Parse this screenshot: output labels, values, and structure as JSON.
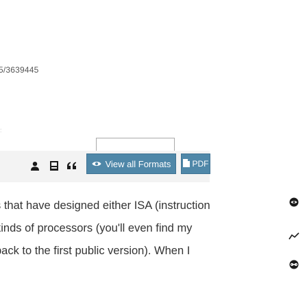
{
  "article": {
    "doi_fragment": "5/3639445",
    "paragraph_lines": [
      "s that have designed either ISA (instruction",
      " kinds of processors (you'll even find my",
      "back to the first public version). When I"
    ]
  },
  "toolbar": {
    "icons": [
      "user-icon",
      "book-icon",
      "quote-icon"
    ],
    "formats_label": "View all Formats",
    "formats_icon": "eye-icon",
    "pdf_label": "PDF",
    "pdf_icon": "pdf-file-icon"
  },
  "side_icons": [
    "view-icon",
    "trend-icon",
    "link-icon"
  ],
  "colors": {
    "button": "#4f87a8",
    "panel": "#f3f3f3",
    "text": "#333333"
  }
}
